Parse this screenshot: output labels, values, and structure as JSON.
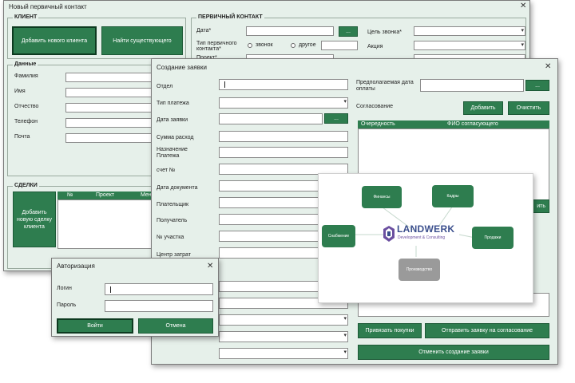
{
  "main": {
    "title": "Новый первичный контакт",
    "client_group": "КЛИЕНТ",
    "new_client_btn": "Добавить нового клиента",
    "find_btn": "Найти существующего",
    "data_group": "Данные",
    "fields": [
      "Фамилия",
      "Имя",
      "Отчество",
      "Телефон",
      "Почта"
    ],
    "deals_group": "СДЕЛКИ",
    "add_deal_btn": "Добавить новую сделку клиента",
    "deals_cols": [
      "№",
      "Проект",
      "Менед"
    ],
    "contact_group": "ПЕРВИЧНЫЙ КОНТАКТ",
    "date_label": "Дата*",
    "dots": "...",
    "type_label": "Тип первичного контакта*",
    "radio_call": "звонок",
    "radio_other": "другое",
    "project_label": "Проект*",
    "call_goal_label": "Цель звонка*",
    "action_label": "Акция"
  },
  "request": {
    "title": "Создание заявки",
    "fields": [
      "Отдел",
      "Тип платежа",
      "Дата заявки",
      "Сумма расход",
      "Назначение Платежа",
      "счет №",
      "Дата документа",
      "Плательщик",
      "Получатель",
      "№ участка",
      "Центр затрат"
    ],
    "due_label": "Предполагаемая дата оплаты",
    "approval_label": "Согласование",
    "add_btn": "Добавить",
    "clear_btn": "Очистить",
    "grid_cols": [
      "Очередность",
      "ФИО согласующего"
    ],
    "partial_btn": "ить",
    "link_btn": "Привязать покупки",
    "send_btn": "Отправить заявку на согласование",
    "cancel_btn": "Отменить создание заявки"
  },
  "auth": {
    "title": "Авторизация",
    "login_label": "Логин",
    "password_label": "Пароль",
    "login_btn": "Войти",
    "cancel_btn": "Отмена"
  },
  "diagram": {
    "logo_name": "LANDWERK",
    "logo_sub": "Development & Consulting",
    "nodes": [
      "Финансы",
      "Кадры",
      "Снабжение",
      "Продажи",
      "Производство"
    ]
  },
  "colors": {
    "accent": "#2e7d4f",
    "window_bg": "#e6f0ea",
    "logo_text": "#3a4e8c"
  }
}
